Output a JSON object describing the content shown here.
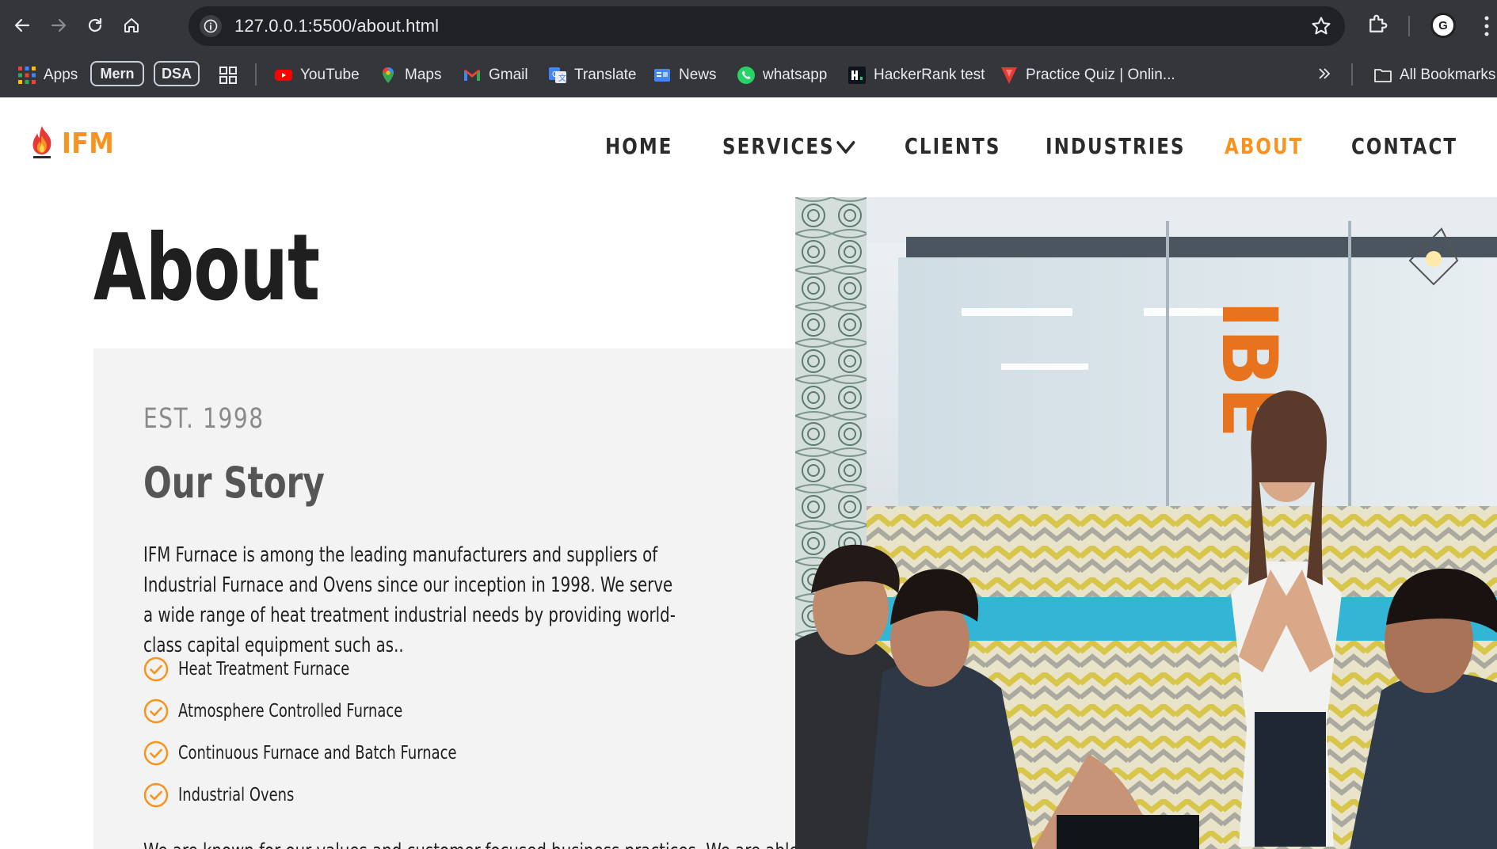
{
  "browser": {
    "url": "127.0.0.1:5500/about.html",
    "bookmarks": [
      {
        "label": "Apps",
        "icon": "apps-grid-icon"
      },
      {
        "label": "Mern",
        "icon": "folder-pill"
      },
      {
        "label": "DSA",
        "icon": "folder-pill"
      },
      {
        "label": "",
        "icon": "tab-groups-icon"
      },
      {
        "label": "YouTube",
        "icon": "youtube-icon"
      },
      {
        "label": "Maps",
        "icon": "maps-icon"
      },
      {
        "label": "Gmail",
        "icon": "gmail-icon"
      },
      {
        "label": "Translate",
        "icon": "translate-icon"
      },
      {
        "label": "News",
        "icon": "news-icon"
      },
      {
        "label": "whatsapp",
        "icon": "whatsapp-icon"
      },
      {
        "label": "HackerRank test",
        "icon": "hackerrank-icon"
      },
      {
        "label": "Practice Quiz | Onlin...",
        "icon": "quiz-icon"
      }
    ],
    "all_bookmarks": "All Bookmarks"
  },
  "site": {
    "logo_text": "IFM",
    "nav": [
      {
        "label": "HOME",
        "active": false
      },
      {
        "label": "SERVICES",
        "active": false,
        "has_dropdown": true
      },
      {
        "label": "CLIENTS",
        "active": false
      },
      {
        "label": "INDUSTRIES",
        "active": false
      },
      {
        "label": "ABOUT",
        "active": true
      },
      {
        "label": "CONTACT",
        "active": false
      }
    ]
  },
  "page": {
    "title": "About",
    "est": "EST. 1998",
    "story_title": "Our Story",
    "story_paragraph": "IFM Furnace is among the leading manufacturers and suppliers of Industrial Furnace and Ovens since our inception in 1998. We serve a wide range of heat treatment industrial needs by providing world-class capital equipment such as..",
    "features": [
      "Heat Treatment Furnace",
      "Atmosphere Controlled Furnace",
      "Continuous Furnace and Batch Furnace",
      "Industrial Ovens"
    ],
    "next_paragraph_partial": "We are known for our values and customer-focused business practices. We are able to"
  },
  "colors": {
    "accent": "#f7931e",
    "dark_text": "#1f1f1f",
    "card_bg": "#f3f3f3",
    "chrome_bg": "#35363a"
  }
}
